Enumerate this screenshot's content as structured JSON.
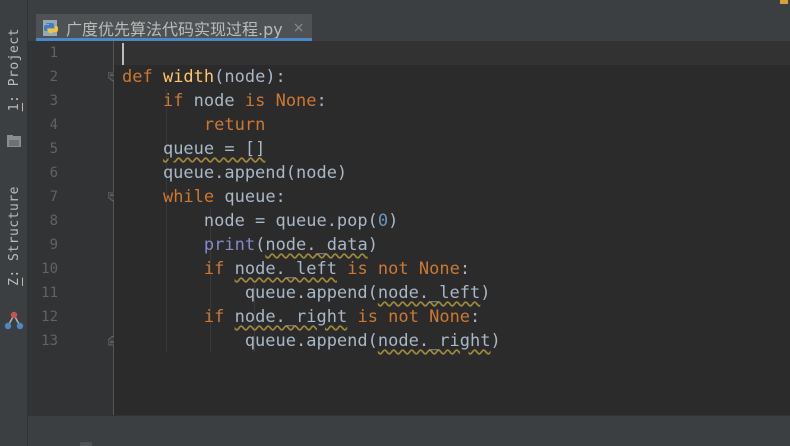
{
  "toolwindows": {
    "project": {
      "number": "1",
      "label": ": Project"
    },
    "structure": {
      "number": "Z",
      "label": ": Structure"
    }
  },
  "editor_tab": {
    "title": "广度优先算法代码实现过程.py",
    "close_glyph": "×",
    "file_icon": "python-file-icon"
  },
  "line_numbers": [
    "1",
    "2",
    "3",
    "4",
    "5",
    "6",
    "7",
    "8",
    "9",
    "10",
    "11",
    "12",
    "13"
  ],
  "code": [
    {
      "n": 1,
      "tokens": []
    },
    {
      "n": 2,
      "tokens": [
        {
          "t": "def ",
          "c": "kw"
        },
        {
          "t": "width",
          "c": "fn"
        },
        {
          "t": "(node):",
          "c": "plain"
        }
      ]
    },
    {
      "n": 3,
      "tokens": [
        {
          "t": "    ",
          "c": "plain"
        },
        {
          "t": "if ",
          "c": "kw"
        },
        {
          "t": "node ",
          "c": "plain"
        },
        {
          "t": "is ",
          "c": "kw"
        },
        {
          "t": "None",
          "c": "kw"
        },
        {
          "t": ":",
          "c": "plain"
        }
      ]
    },
    {
      "n": 4,
      "tokens": [
        {
          "t": "        ",
          "c": "plain"
        },
        {
          "t": "return",
          "c": "kw"
        }
      ]
    },
    {
      "n": 5,
      "tokens": [
        {
          "t": "    ",
          "c": "plain"
        },
        {
          "t": "queue = []",
          "c": "plain",
          "w": true
        }
      ]
    },
    {
      "n": 6,
      "tokens": [
        {
          "t": "    queue.append(node)",
          "c": "plain"
        }
      ]
    },
    {
      "n": 7,
      "tokens": [
        {
          "t": "    ",
          "c": "plain"
        },
        {
          "t": "while ",
          "c": "kw"
        },
        {
          "t": "queue:",
          "c": "plain"
        }
      ]
    },
    {
      "n": 8,
      "tokens": [
        {
          "t": "        node = queue.pop(",
          "c": "plain"
        },
        {
          "t": "0",
          "c": "num"
        },
        {
          "t": ")",
          "c": "plain"
        }
      ]
    },
    {
      "n": 9,
      "tokens": [
        {
          "t": "        ",
          "c": "plain"
        },
        {
          "t": "print",
          "c": "bi"
        },
        {
          "t": "(",
          "c": "plain"
        },
        {
          "t": "node._data",
          "c": "plain",
          "w": true
        },
        {
          "t": ")",
          "c": "plain"
        }
      ]
    },
    {
      "n": 10,
      "tokens": [
        {
          "t": "        ",
          "c": "plain"
        },
        {
          "t": "if ",
          "c": "kw"
        },
        {
          "t": "node._left",
          "c": "plain",
          "w": true
        },
        {
          "t": " ",
          "c": "plain"
        },
        {
          "t": "is not None",
          "c": "kw"
        },
        {
          "t": ":",
          "c": "plain"
        }
      ]
    },
    {
      "n": 11,
      "tokens": [
        {
          "t": "            queue.append(",
          "c": "plain"
        },
        {
          "t": "node._left",
          "c": "plain",
          "w": true
        },
        {
          "t": ")",
          "c": "plain"
        }
      ]
    },
    {
      "n": 12,
      "tokens": [
        {
          "t": "        ",
          "c": "plain"
        },
        {
          "t": "if ",
          "c": "kw"
        },
        {
          "t": "node._right",
          "c": "plain",
          "w": true
        },
        {
          "t": " ",
          "c": "plain"
        },
        {
          "t": "is not None",
          "c": "kw"
        },
        {
          "t": ":",
          "c": "plain"
        }
      ]
    },
    {
      "n": 13,
      "tokens": [
        {
          "t": "            queue.append(",
          "c": "plain"
        },
        {
          "t": "node._right",
          "c": "plain",
          "w": true
        },
        {
          "t": ")",
          "c": "plain"
        }
      ]
    }
  ],
  "current_line": 1,
  "colors": {
    "background": "#2b2b2b",
    "keyword": "#cc7832",
    "function_name": "#ffc66d",
    "builtin": "#8888c6",
    "number": "#6897bb",
    "default_text": "#a9b7c6",
    "line_number": "#606366",
    "tab_accent": "#4a88c7"
  }
}
